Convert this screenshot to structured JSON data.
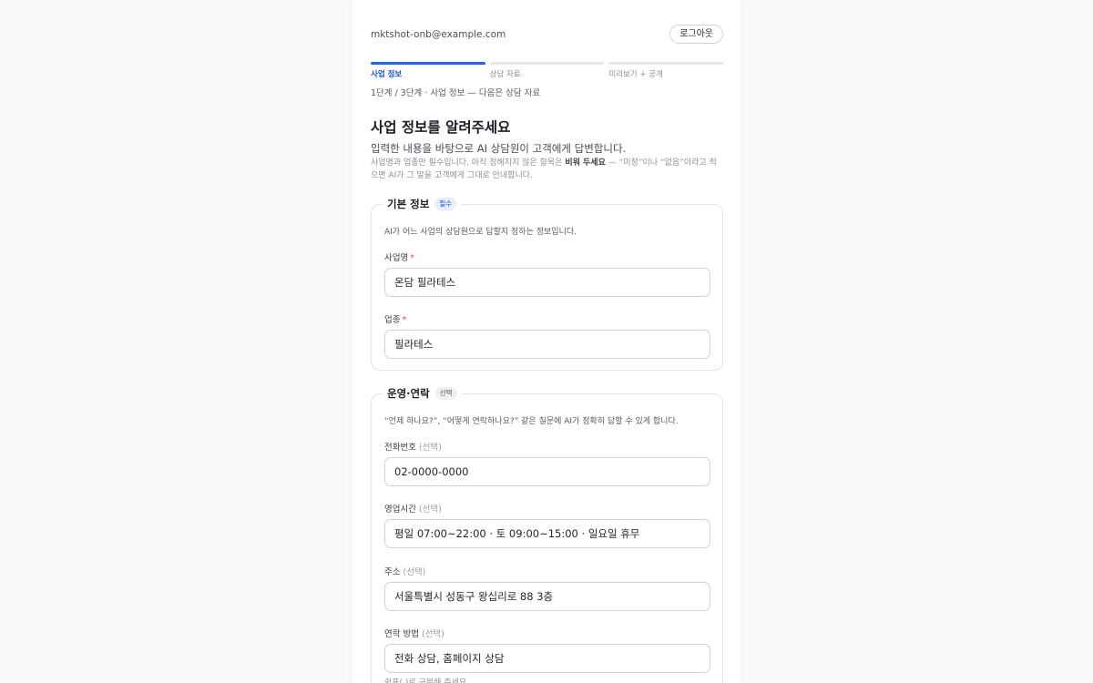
{
  "header": {
    "email": "mktshot-onb@example.com",
    "logout_label": "로그아웃"
  },
  "steps": [
    {
      "label": "사업 정보",
      "active": true
    },
    {
      "label": "상담 자료",
      "active": false
    },
    {
      "label": "미리보기 + 공개",
      "active": false
    }
  ],
  "progress_text": "1단계 / 3단계 · 사업 정보 — 다음은 상담 자료",
  "page": {
    "title": "사업 정보를 알려주세요",
    "subtitle": "입력한 내용을 바탕으로 AI 상담원이 고객에게 답변합니다.",
    "hint_before": "사업명과 업종만 필수입니다. 아직 정해지지 않은 항목은 ",
    "hint_bold": "비워 두세요",
    "hint_after": " — “미정”이나 “없음”이라고 적으면 AI가 그 말을 고객에게 그대로 안내합니다."
  },
  "basic": {
    "title": "기본 정보",
    "badge": "필수",
    "description": "AI가 어느 사업의 상담원으로 답할지 정하는 정보입니다.",
    "business_name_label": "사업명",
    "business_name_value": "온담 필라테스",
    "industry_label": "업종",
    "industry_value": "필라테스",
    "required_mark": "*"
  },
  "ops": {
    "title": "운영·연락",
    "badge": "선택",
    "description": "“언제 하나요?”, “어떻게 연락하나요?” 같은 질문에 AI가 정확히 답할 수 있게 합니다.",
    "optional_tag": "(선택)",
    "phone_label": "전화번호",
    "phone_value": "02-0000-0000",
    "hours_label": "영업시간",
    "hours_value": "평일 07:00~22:00 · 토 09:00~15:00 · 일요일 휴무",
    "address_label": "주소",
    "address_value": "서울특별시 성동구 왕십리로 88 3층",
    "contact_label": "연락 방법",
    "contact_value": "전화 상담, 홈페이지 상담",
    "contact_helper": "쉼표(,)로 구분해 주세요"
  },
  "colors": {
    "accent": "#2563eb",
    "required": "#e5484d"
  }
}
